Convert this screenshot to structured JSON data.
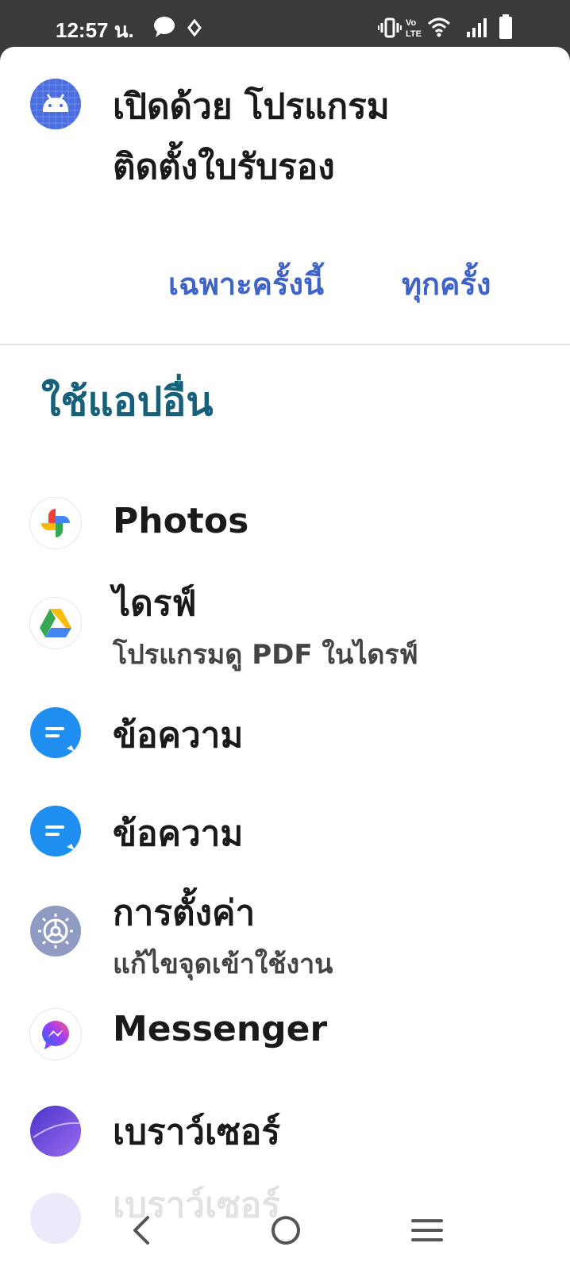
{
  "status_bar": {
    "time": "12:57 น.",
    "icons": [
      "chat-bubble-icon",
      "location-icon",
      "vibrate-icon",
      "volte-icon",
      "wifi-icon",
      "signal-icon",
      "battery-icon"
    ]
  },
  "dialog": {
    "title_line1": "เปิดด้วย โปรแกรม",
    "title_line2": "ติดตั้งใบรับรอง",
    "header_icon": "android-icon",
    "actions": {
      "just_once": "เฉพาะครั้งนี้",
      "always": "ทุกครั้ง"
    },
    "accent_color": "#3f63c7",
    "section_color": "#16607a"
  },
  "other_apps": {
    "heading": "ใช้แอปอื่น",
    "apps": [
      {
        "name": "Photos",
        "subtitle": "",
        "icon": "google-photos-icon"
      },
      {
        "name": "ไดรฟ์",
        "subtitle": "โปรแกรมดู PDF ในไดรฟ์",
        "icon": "google-drive-icon"
      },
      {
        "name": "ข้อความ",
        "subtitle": "",
        "icon": "messages-icon"
      },
      {
        "name": "ข้อความ",
        "subtitle": "",
        "icon": "messages-icon"
      },
      {
        "name": "การตั้งค่า",
        "subtitle": "แก้ไขจุดเข้าใช้งาน",
        "icon": "settings-gear-icon"
      },
      {
        "name": "Messenger",
        "subtitle": "",
        "icon": "messenger-icon"
      },
      {
        "name": "เบราว์เซอร์",
        "subtitle": "",
        "icon": "browser-icon"
      },
      {
        "name": "เบราว์เซอร์",
        "subtitle": "",
        "icon": "browser-icon"
      }
    ]
  },
  "nav_bar": {
    "back": "back-icon",
    "home": "home-icon",
    "recents": "recents-icon"
  }
}
